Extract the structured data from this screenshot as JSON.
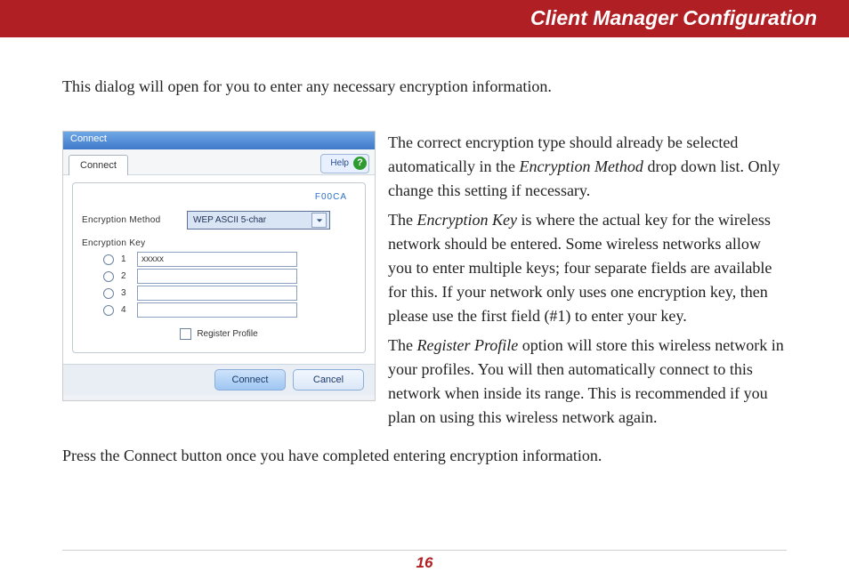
{
  "header": {
    "title": "Client Manager Configuration"
  },
  "intro": "This dialog will open for you to enter any necessary encryption information.",
  "dialog": {
    "titlebar": "Connect",
    "tab": "Connect",
    "help_label": "Help",
    "network_name": "F00CA",
    "enc_method_label": "Encryption Method",
    "enc_method_value": "WEP ASCII 5-char",
    "enc_key_label": "Encryption Key",
    "keys": [
      {
        "num": "1",
        "value": "xxxxx"
      },
      {
        "num": "2",
        "value": ""
      },
      {
        "num": "3",
        "value": ""
      },
      {
        "num": "4",
        "value": ""
      }
    ],
    "register_profile_label": "Register Profile",
    "connect_btn": "Connect",
    "cancel_btn": "Cancel"
  },
  "body": {
    "p1a": "The correct encryption type should already be selected automatically in the ",
    "p1_em": "Encryption Method",
    "p1b": " drop down list.  Only change this setting if necessary.",
    "p2a": "The ",
    "p2_em": "Encryption Key",
    "p2b": " is where the actual key for the wireless network should be entered.  Some wireless networks allow you to enter multiple keys; four separate fields are available for this.  If your network only uses one encryption key, then please use the first field (#1) to enter your key.",
    "p3a": "The ",
    "p3_em": "Register Profile",
    "p3b": " option will store this wireless network in your profiles.  You will then automatically connect to this network when inside its range.  This is recommended if you plan on using this wireless network again.",
    "p4a": "Press the ",
    "p4_em": "Connect",
    "p4b": " button once you have completed entering encryption information."
  },
  "page_number": "16"
}
